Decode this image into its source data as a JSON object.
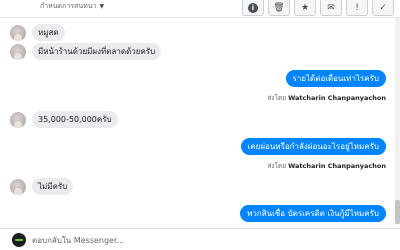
{
  "header": {
    "assign_label": "กำหนดการสนทนา",
    "actions": [
      {
        "name": "info-icon",
        "glyph": "!"
      },
      {
        "name": "trash-icon",
        "glyph": "🗑"
      },
      {
        "name": "star-icon",
        "glyph": "★"
      },
      {
        "name": "mail-icon",
        "glyph": "✉"
      },
      {
        "name": "alert-icon",
        "glyph": "!"
      },
      {
        "name": "check-icon",
        "glyph": "✓"
      }
    ]
  },
  "messages": [
    {
      "dir": "in",
      "text": "หมูสด"
    },
    {
      "dir": "in",
      "text": "มีหน้าร้านด้วยมีผงที่ตลาดด้วยครับ"
    },
    {
      "dir": "out",
      "text": "รายได้ต่อเดือนเท่าไรครับ",
      "sent_by_prefix": "ส่งโดย",
      "sent_by_name": "Watcharin Chanpanyachon"
    },
    {
      "dir": "in",
      "text": "35,000-50,000ครับ"
    },
    {
      "dir": "out",
      "text": "เคยผ่อนหรือกำลังผ่อนอะไรอยู่ไหมครับ",
      "sent_by_prefix": "ส่งโดย",
      "sent_by_name": "Watcharin Chanpanyachon"
    },
    {
      "dir": "in",
      "text": "ไม่มีครับ"
    },
    {
      "dir": "out",
      "text": "พวกสินเชื่อ บัตรเครดิต เงินกู้มีไหมครับ"
    }
  ],
  "composer": {
    "placeholder": "ตอบกลับใน Messenger..."
  },
  "colors": {
    "outgoing": "#0084ff",
    "incoming": "#e9ebee"
  }
}
